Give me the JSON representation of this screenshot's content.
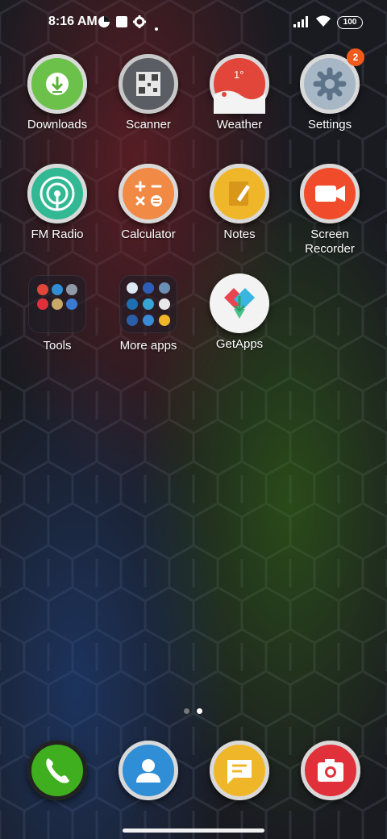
{
  "status_bar": {
    "time": "8:16 AM",
    "battery": "100",
    "icons": [
      "data-saver-icon",
      "notification-square-icon",
      "gear-icon",
      "dot-icon",
      "signal-icon",
      "wifi-icon",
      "battery-icon"
    ]
  },
  "apps": {
    "downloads": {
      "label": "Downloads",
      "icon": "download-icon",
      "color": "#6bc14a"
    },
    "scanner": {
      "label": "Scanner",
      "icon": "qr-code-icon",
      "color": "#5a5d64"
    },
    "weather": {
      "label": "Weather",
      "icon": "weather-icon",
      "color": "#e2463a",
      "temperature": "1°"
    },
    "settings": {
      "label": "Settings",
      "icon": "gear-icon",
      "color": "#a7b7c6",
      "badge": "2"
    },
    "fm_radio": {
      "label": "FM Radio",
      "icon": "radio-icon",
      "color": "#33b894"
    },
    "calculator": {
      "label": "Calculator",
      "icon": "calculator-icon",
      "color": "#f18a45"
    },
    "notes": {
      "label": "Notes",
      "icon": "notes-icon",
      "color": "#f0b62a"
    },
    "screen_recorder": {
      "label": "Screen\nRecorder",
      "label_line1": "Screen",
      "label_line2": "Recorder",
      "icon": "video-camera-icon",
      "color": "#f04c2b"
    },
    "tools": {
      "label": "Tools",
      "icon": "folder-icon"
    },
    "more_apps": {
      "label": "More apps",
      "icon": "folder-icon"
    },
    "getapps": {
      "label": "GetApps",
      "icon": "getapps-icon"
    }
  },
  "page_indicator": {
    "pages": 2,
    "active": 2
  },
  "dock": [
    {
      "name": "phone",
      "icon": "phone-icon",
      "color": "#3fae1f"
    },
    {
      "name": "contacts",
      "icon": "contacts-icon",
      "color": "#2f8ed6"
    },
    {
      "name": "messages",
      "icon": "messages-icon",
      "color": "#f0b62a"
    },
    {
      "name": "camera",
      "icon": "camera-icon",
      "color": "#e0303a"
    }
  ]
}
